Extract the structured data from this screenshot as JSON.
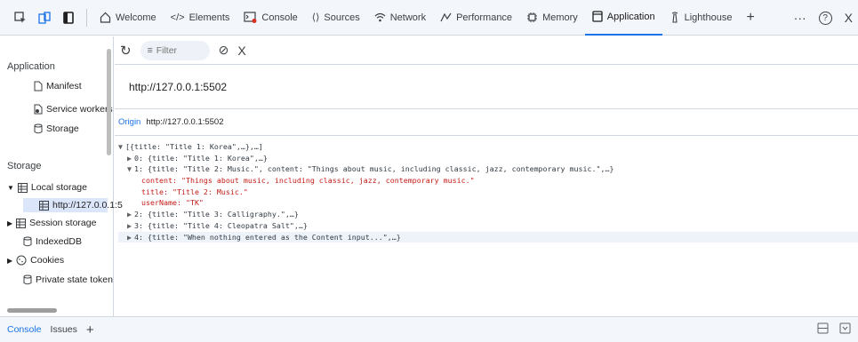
{
  "toptabs": {
    "items": [
      {
        "label": "Welcome"
      },
      {
        "label": "Elements"
      },
      {
        "label": "Console"
      },
      {
        "label": "Sources"
      },
      {
        "label": "Network"
      },
      {
        "label": "Performance"
      },
      {
        "label": "Memory"
      },
      {
        "label": "Application"
      },
      {
        "label": "Lighthouse"
      }
    ],
    "active": "Application",
    "add_label": "+",
    "more_label": "···",
    "help_label": "?",
    "close_label": "X"
  },
  "sidebar": {
    "app_section": "Application",
    "app_items": [
      "Manifest",
      "Service workers",
      "Storage"
    ],
    "storage_section": "Storage",
    "storage_items": [
      "Local storage",
      "http://127.0.0.1:5",
      "Session storage",
      "IndexedDB",
      "Cookies",
      "Private state token"
    ]
  },
  "toolbar": {
    "refresh_icon": "refresh-icon",
    "filter_placeholder": "Filter",
    "clear_icon": "clear-icon",
    "close_label": "X"
  },
  "main": {
    "url": "http://127.0.0.1:5502",
    "origin_label": "Origin",
    "origin_value": "http://127.0.0.1:5502"
  },
  "data_view": {
    "lines": [
      "[{title: \"Title 1: Korea\",…},…]",
      "0: {title: \"Title 1: Korea\",…}",
      "1: {title: \"Title 2: Music.\", content: \"Things about music, including classic, jazz, contemporary music.\",…}",
      "content: \"Things about music, including classic, jazz, contemporary music.\"",
      "title: \"Title 2: Music.\"",
      "userName: \"TK\"",
      "2: {title: \"Title 3: Calligraphy.\",…}",
      "3: {title: \"Title 4: Cleopatra Salt\",…}",
      "4: {title: \"When nothing entered as the Content input...\",…}"
    ]
  },
  "bottom": {
    "tabs": [
      "Console",
      "Issues"
    ],
    "add_label": "+"
  },
  "colors": {
    "accent": "#1a73e8",
    "key": "#881391",
    "string": "#c41a16"
  }
}
